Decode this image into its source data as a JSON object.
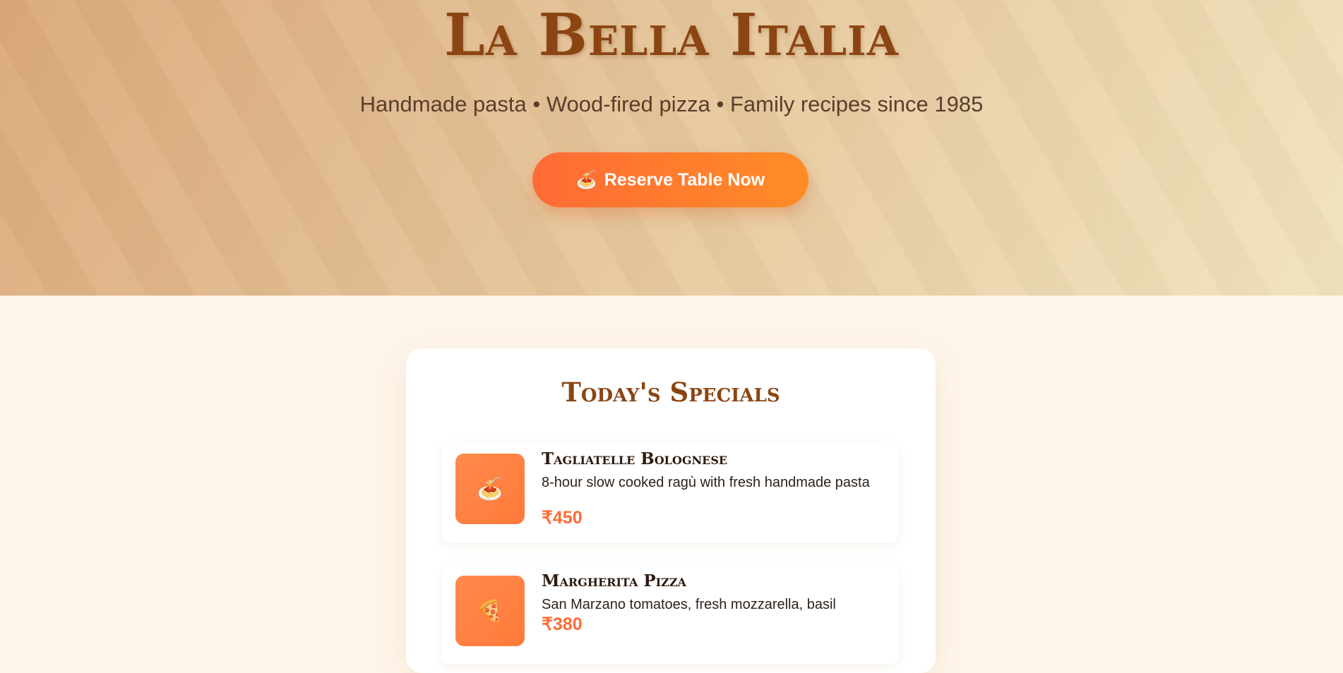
{
  "hero": {
    "title": "La Bella Italia",
    "subtitle": "Handmade pasta • Wood-fired pizza • Family recipes since 1985",
    "reserve_button": {
      "icon": "🍝",
      "label": "Reserve Table Now"
    }
  },
  "specials": {
    "title": "Today's Specials",
    "items": [
      {
        "icon": "🍝",
        "icon_name": "pasta-icon",
        "name": "Tagliatelle Bolognese",
        "description": "8-hour slow cooked ragù with fresh handmade pasta",
        "price": "₹450"
      },
      {
        "icon": "🍕",
        "icon_name": "pizza-icon",
        "name": "Margherita Pizza",
        "description": "San Marzano tomatoes, fresh mozzarella, basil",
        "price": "₹380"
      }
    ]
  },
  "colors": {
    "brand_brown": "#8b4513",
    "accent_orange": "#ff6b35",
    "page_background": "#fef5e9"
  }
}
